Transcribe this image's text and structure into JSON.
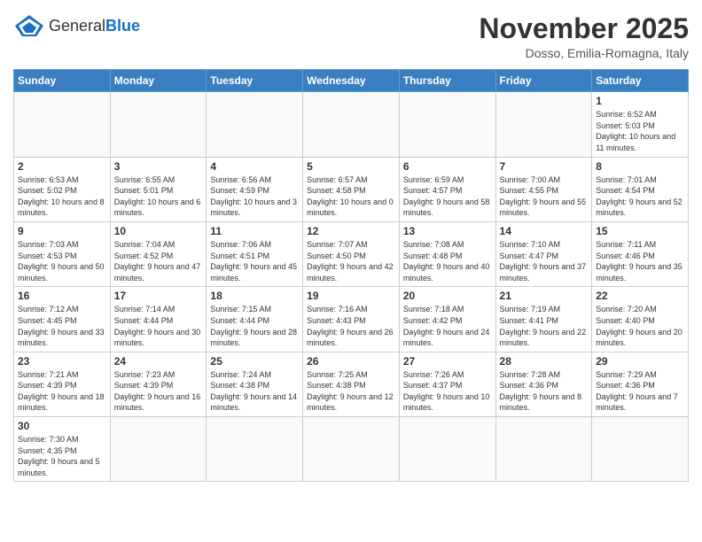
{
  "header": {
    "logo_text_general": "General",
    "logo_text_blue": "Blue",
    "month_year": "November 2025",
    "location": "Dosso, Emilia-Romagna, Italy"
  },
  "weekdays": [
    "Sunday",
    "Monday",
    "Tuesday",
    "Wednesday",
    "Thursday",
    "Friday",
    "Saturday"
  ],
  "weeks": [
    [
      {
        "day": "",
        "info": ""
      },
      {
        "day": "",
        "info": ""
      },
      {
        "day": "",
        "info": ""
      },
      {
        "day": "",
        "info": ""
      },
      {
        "day": "",
        "info": ""
      },
      {
        "day": "",
        "info": ""
      },
      {
        "day": "1",
        "info": "Sunrise: 6:52 AM\nSunset: 5:03 PM\nDaylight: 10 hours and 11 minutes."
      }
    ],
    [
      {
        "day": "2",
        "info": "Sunrise: 6:53 AM\nSunset: 5:02 PM\nDaylight: 10 hours and 8 minutes."
      },
      {
        "day": "3",
        "info": "Sunrise: 6:55 AM\nSunset: 5:01 PM\nDaylight: 10 hours and 6 minutes."
      },
      {
        "day": "4",
        "info": "Sunrise: 6:56 AM\nSunset: 4:59 PM\nDaylight: 10 hours and 3 minutes."
      },
      {
        "day": "5",
        "info": "Sunrise: 6:57 AM\nSunset: 4:58 PM\nDaylight: 10 hours and 0 minutes."
      },
      {
        "day": "6",
        "info": "Sunrise: 6:59 AM\nSunset: 4:57 PM\nDaylight: 9 hours and 58 minutes."
      },
      {
        "day": "7",
        "info": "Sunrise: 7:00 AM\nSunset: 4:55 PM\nDaylight: 9 hours and 55 minutes."
      },
      {
        "day": "8",
        "info": "Sunrise: 7:01 AM\nSunset: 4:54 PM\nDaylight: 9 hours and 52 minutes."
      }
    ],
    [
      {
        "day": "9",
        "info": "Sunrise: 7:03 AM\nSunset: 4:53 PM\nDaylight: 9 hours and 50 minutes."
      },
      {
        "day": "10",
        "info": "Sunrise: 7:04 AM\nSunset: 4:52 PM\nDaylight: 9 hours and 47 minutes."
      },
      {
        "day": "11",
        "info": "Sunrise: 7:06 AM\nSunset: 4:51 PM\nDaylight: 9 hours and 45 minutes."
      },
      {
        "day": "12",
        "info": "Sunrise: 7:07 AM\nSunset: 4:50 PM\nDaylight: 9 hours and 42 minutes."
      },
      {
        "day": "13",
        "info": "Sunrise: 7:08 AM\nSunset: 4:48 PM\nDaylight: 9 hours and 40 minutes."
      },
      {
        "day": "14",
        "info": "Sunrise: 7:10 AM\nSunset: 4:47 PM\nDaylight: 9 hours and 37 minutes."
      },
      {
        "day": "15",
        "info": "Sunrise: 7:11 AM\nSunset: 4:46 PM\nDaylight: 9 hours and 35 minutes."
      }
    ],
    [
      {
        "day": "16",
        "info": "Sunrise: 7:12 AM\nSunset: 4:45 PM\nDaylight: 9 hours and 33 minutes."
      },
      {
        "day": "17",
        "info": "Sunrise: 7:14 AM\nSunset: 4:44 PM\nDaylight: 9 hours and 30 minutes."
      },
      {
        "day": "18",
        "info": "Sunrise: 7:15 AM\nSunset: 4:44 PM\nDaylight: 9 hours and 28 minutes."
      },
      {
        "day": "19",
        "info": "Sunrise: 7:16 AM\nSunset: 4:43 PM\nDaylight: 9 hours and 26 minutes."
      },
      {
        "day": "20",
        "info": "Sunrise: 7:18 AM\nSunset: 4:42 PM\nDaylight: 9 hours and 24 minutes."
      },
      {
        "day": "21",
        "info": "Sunrise: 7:19 AM\nSunset: 4:41 PM\nDaylight: 9 hours and 22 minutes."
      },
      {
        "day": "22",
        "info": "Sunrise: 7:20 AM\nSunset: 4:40 PM\nDaylight: 9 hours and 20 minutes."
      }
    ],
    [
      {
        "day": "23",
        "info": "Sunrise: 7:21 AM\nSunset: 4:39 PM\nDaylight: 9 hours and 18 minutes."
      },
      {
        "day": "24",
        "info": "Sunrise: 7:23 AM\nSunset: 4:39 PM\nDaylight: 9 hours and 16 minutes."
      },
      {
        "day": "25",
        "info": "Sunrise: 7:24 AM\nSunset: 4:38 PM\nDaylight: 9 hours and 14 minutes."
      },
      {
        "day": "26",
        "info": "Sunrise: 7:25 AM\nSunset: 4:38 PM\nDaylight: 9 hours and 12 minutes."
      },
      {
        "day": "27",
        "info": "Sunrise: 7:26 AM\nSunset: 4:37 PM\nDaylight: 9 hours and 10 minutes."
      },
      {
        "day": "28",
        "info": "Sunrise: 7:28 AM\nSunset: 4:36 PM\nDaylight: 9 hours and 8 minutes."
      },
      {
        "day": "29",
        "info": "Sunrise: 7:29 AM\nSunset: 4:36 PM\nDaylight: 9 hours and 7 minutes."
      }
    ],
    [
      {
        "day": "30",
        "info": "Sunrise: 7:30 AM\nSunset: 4:35 PM\nDaylight: 9 hours and 5 minutes."
      },
      {
        "day": "",
        "info": ""
      },
      {
        "day": "",
        "info": ""
      },
      {
        "day": "",
        "info": ""
      },
      {
        "day": "",
        "info": ""
      },
      {
        "day": "",
        "info": ""
      },
      {
        "day": "",
        "info": ""
      }
    ]
  ]
}
